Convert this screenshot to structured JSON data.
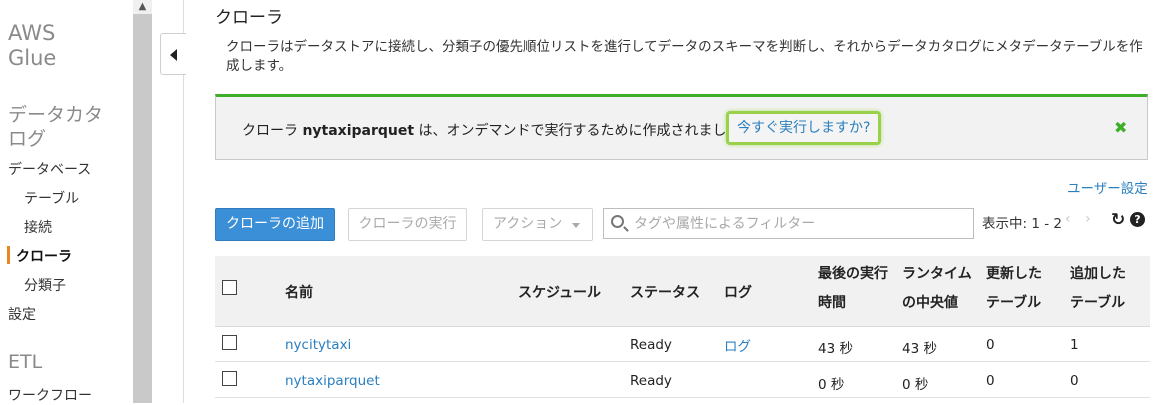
{
  "sidebar": {
    "brand_line1": "AWS",
    "brand_line2": "Glue",
    "catalog_title_line1": "データカタ",
    "catalog_title_line2": "ログ",
    "items": [
      {
        "label": "データベース",
        "level": "top"
      },
      {
        "label": "テーブル",
        "level": "sub"
      },
      {
        "label": "接続",
        "level": "sub"
      },
      {
        "label": "クローラ",
        "level": "sub",
        "active": true
      },
      {
        "label": "分類子",
        "level": "sub"
      },
      {
        "label": "設定",
        "level": "top"
      }
    ],
    "etl_title": "ETL",
    "etl_items": [
      {
        "label": "ワークフロー"
      }
    ]
  },
  "main": {
    "title": "クローラ",
    "description": "クローラはデータストアに接続し、分類子の優先順位リストを進行してデータのスキーマを判断し、それからデータカタログにメタデータテーブルを作成します。",
    "banner": {
      "prefix": "クローラ ",
      "crawler_name": "nytaxiparquet",
      "suffix": " は、オンデマンドで実行するために作成されました。",
      "link": "今すぐ実行しますか?",
      "close_icon": "close-icon",
      "accent_color": "#3fae29"
    },
    "user_settings": "ユーザー設定",
    "toolbar": {
      "add_label": "クローラの追加",
      "run_label": "クローラの実行",
      "action_label": "アクション",
      "filter_placeholder": "タグや属性によるフィルター",
      "filter_value": "",
      "paging": "表示中: 1 - 2",
      "prev": "‹",
      "next": "›"
    },
    "table": {
      "columns": {
        "name": "名前",
        "schedule": "スケジュール",
        "status": "ステータス",
        "log": "ログ",
        "last_run_1": "最後の実行",
        "last_run_2": "時間",
        "median_1": "ランタイム",
        "median_2": "の中央値",
        "updated_1": "更新した",
        "updated_2": "テーブル",
        "added_1": "追加した",
        "added_2": "テーブル"
      },
      "rows": [
        {
          "name": "nycitytaxi",
          "schedule": "",
          "status": "Ready",
          "log": "ログ",
          "last_run": "43 秒",
          "median": "43 秒",
          "updated": "0",
          "added": "1"
        },
        {
          "name": "nytaxiparquet",
          "schedule": "",
          "status": "Ready",
          "log": "",
          "last_run": "0 秒",
          "median": "0 秒",
          "updated": "0",
          "added": "0"
        }
      ]
    }
  }
}
